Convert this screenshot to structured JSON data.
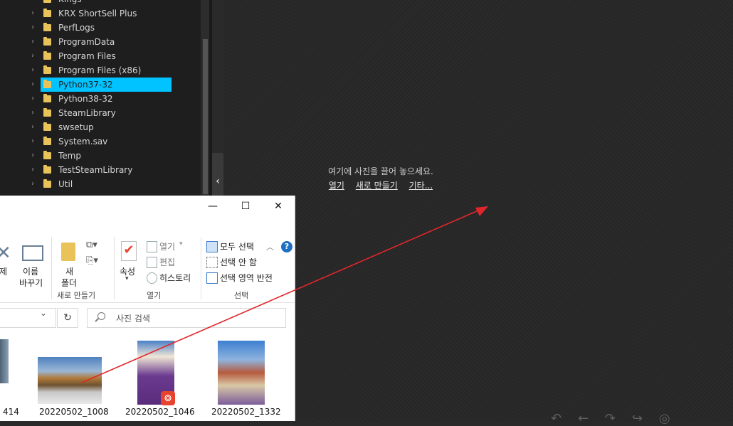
{
  "tree": {
    "items": [
      {
        "label": "Kings"
      },
      {
        "label": "KRX ShortSell Plus"
      },
      {
        "label": "PerfLogs"
      },
      {
        "label": "ProgramData"
      },
      {
        "label": "Program Files"
      },
      {
        "label": "Program Files (x86)"
      },
      {
        "label": "Python37-32",
        "selected": true
      },
      {
        "label": "Python38-32"
      },
      {
        "label": "SteamLibrary"
      },
      {
        "label": "swsetup"
      },
      {
        "label": "System.sav"
      },
      {
        "label": "Temp"
      },
      {
        "label": "TestSteamLibrary"
      },
      {
        "label": "Util"
      }
    ]
  },
  "canvas": {
    "hint": "여기에 사진을 끌어 놓으세요.",
    "link_open": "열기",
    "link_new": "새로 만들기",
    "link_other": "기타..."
  },
  "explorer": {
    "ribbon": {
      "delete_label": "삭제",
      "rename_label_1": "이름",
      "rename_label_2": "바꾸기",
      "new_folder_1": "새",
      "new_folder_2": "폴더",
      "group_new": "새로 만들기",
      "properties": "속성",
      "open": "열기",
      "edit": "편집",
      "history": "히스토리",
      "group_open": "열기",
      "select_all": "모두 선택",
      "select_none": "선택 안 함",
      "invert_selection": "선택 영역 반전",
      "group_select": "선택"
    },
    "search_placeholder": "사진 검색",
    "files": [
      {
        "label": "414"
      },
      {
        "label": "20220502_1008"
      },
      {
        "label": "20220502_1046"
      },
      {
        "label": "20220502_1332"
      }
    ]
  },
  "colors": {
    "selection": "#00c3ff",
    "arrow": "#e0262b",
    "folder": "#e9c25a",
    "help": "#1f6fc5"
  }
}
